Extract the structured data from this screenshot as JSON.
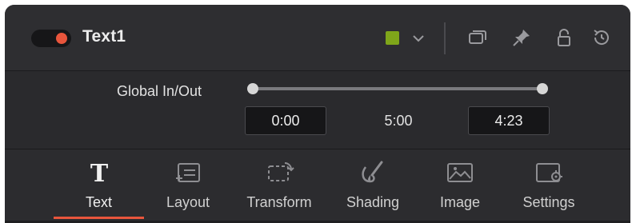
{
  "header": {
    "title": "Text1",
    "toggle_state": "on",
    "accent_color": "#e8553c",
    "color_swatch": "#7fa61a",
    "icons": [
      "toggle-icon",
      "color-swatch",
      "chevron-down-icon",
      "versions-icon",
      "pin-icon",
      "lock-icon",
      "reset-icon"
    ]
  },
  "inout": {
    "label": "Global In/Out",
    "in_value": "0:00",
    "duration": "5:00",
    "out_value": "4:23"
  },
  "tabs": [
    {
      "label": "Text",
      "icon": "text-t-icon",
      "active": true
    },
    {
      "label": "Layout",
      "icon": "layout-icon",
      "active": false
    },
    {
      "label": "Transform",
      "icon": "transform-icon",
      "active": false
    },
    {
      "label": "Shading",
      "icon": "shading-brush-icon",
      "active": false
    },
    {
      "label": "Image",
      "icon": "image-icon",
      "active": false
    },
    {
      "label": "Settings",
      "icon": "settings-icon",
      "active": false
    }
  ],
  "colors": {
    "background": "#2b2b2e",
    "field_bg": "#161618",
    "active_underline": "#e8553c"
  }
}
